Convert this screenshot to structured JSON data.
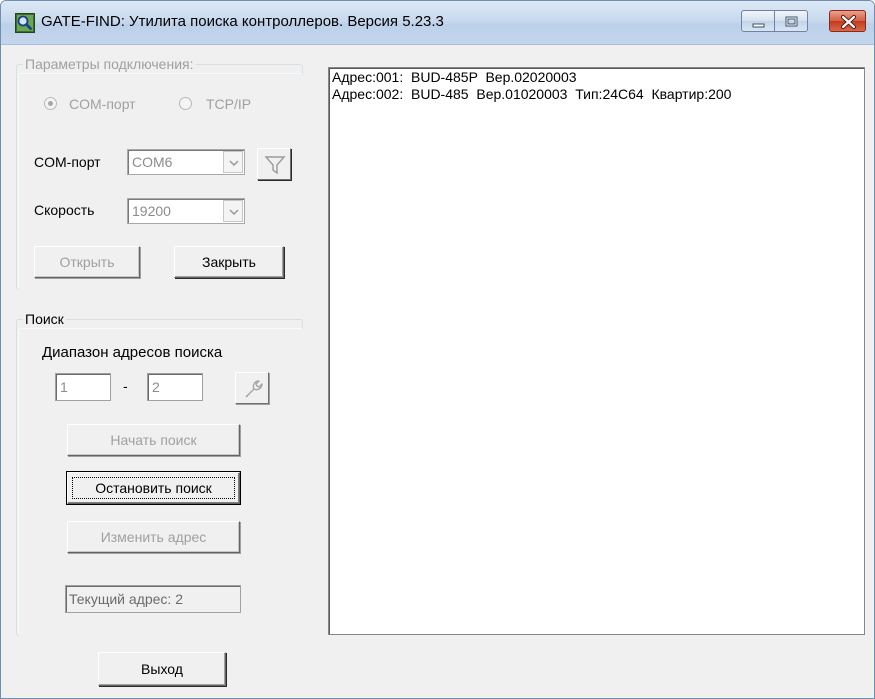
{
  "window": {
    "title": "GATE-FIND: Утилита поиска контроллеров. Версия 5.23.3",
    "icons": [
      "app-magnifier-icon",
      "minimize-icon",
      "maximize-icon",
      "close-icon"
    ]
  },
  "connection": {
    "legend": "Параметры подключения:",
    "radio_com_label": "COM-порт",
    "radio_tcp_label": "TCP/IP",
    "selected": "COM-порт",
    "com_port_label": "COM-порт",
    "com_port_value": "COM6",
    "speed_label": "Скорость",
    "speed_value": "19200",
    "open_button": "Открыть",
    "close_button": "Закрыть"
  },
  "search": {
    "legend": "Поиск",
    "range_label": "Диапазон адресов поиска",
    "range_from": "1",
    "range_dash": "-",
    "range_to": "2",
    "start_button": "Начать поиск",
    "stop_button": "Остановить поиск",
    "change_button": "Изменить адрес",
    "current_address": "Текущий адрес: 2"
  },
  "results": [
    "Адрес:001:  BUD-485P  Вер.02020003",
    "Адрес:002:  BUD-485  Вер.01020003  Тип:24C64  Квартир:200"
  ],
  "footer": {
    "exit_button": "Выход"
  }
}
